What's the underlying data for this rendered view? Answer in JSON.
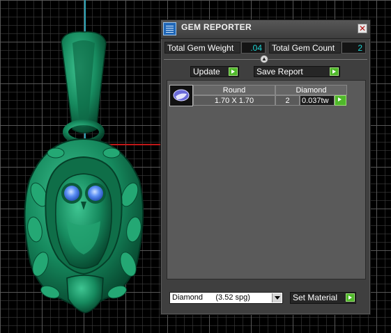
{
  "window": {
    "title": "GEM REPORTER",
    "close_glyph": "✕"
  },
  "stats": {
    "total_weight_label": "Total Gem Weight",
    "total_weight_value": ".04",
    "total_count_label": "Total Gem Count",
    "total_count_value": "2"
  },
  "buttons": {
    "update": "Update",
    "save_report": "Save Report",
    "set_material": "Set Material"
  },
  "gem_table": {
    "header": {
      "shape": "Round",
      "material": "Diamond"
    },
    "row": {
      "size": "1.70 X 1.70",
      "count": "2",
      "weight": "0.037tw"
    }
  },
  "material_select": {
    "value": "Diamond      (3.52 spg)"
  },
  "icons": [
    "gem-reporter-app-icon",
    "close-icon",
    "collapse-arrow-icon",
    "play-arrow-icon",
    "gem-shape-icon",
    "chevron-down-icon"
  ],
  "colors": {
    "value_text": "#1fd6d6",
    "play_button": "#4fb82a",
    "model_green": "#1d8a60",
    "gem_blue": "#4f86f0"
  }
}
